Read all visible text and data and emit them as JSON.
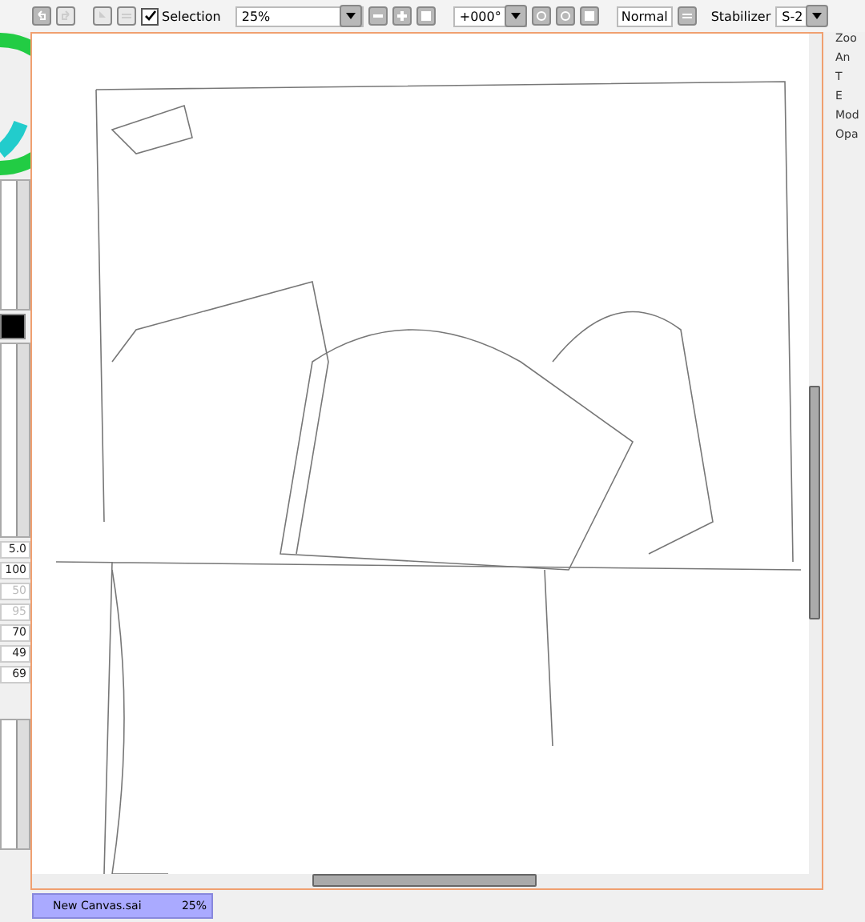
{
  "toolbar": {
    "selection": {
      "label": "Selection",
      "checked": true
    },
    "zoom": "25%",
    "rotation": "+000°",
    "blend": "Normal",
    "stabilizer_label": "Stabilizer",
    "stabilizer": "S-2"
  },
  "left_panel": {
    "brush_size": "5.0",
    "values": [
      {
        "text": "100",
        "disabled": false
      },
      {
        "text": "50",
        "disabled": true
      },
      {
        "text": "95",
        "disabled": true
      },
      {
        "text": "70",
        "disabled": false
      },
      {
        "text": "49",
        "disabled": false
      },
      {
        "text": "69",
        "disabled": false
      }
    ]
  },
  "right_panel": {
    "labels": [
      "Zoo",
      "An",
      "T",
      "E",
      "Mod",
      "Opa"
    ]
  },
  "documents": [
    {
      "name": "New Canvas.sai",
      "zoom": "25%",
      "selected": true
    }
  ]
}
